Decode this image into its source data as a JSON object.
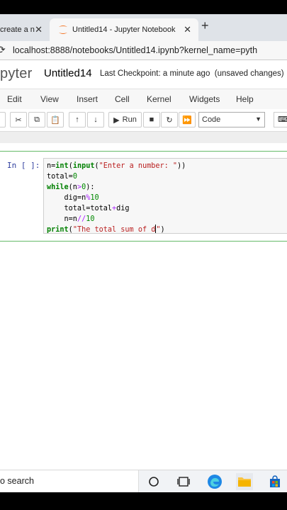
{
  "browser": {
    "tabs": [
      {
        "label": "create a n"
      },
      {
        "label": "Untitled14 - Jupyter Notebook"
      }
    ],
    "new_tab": "+",
    "url": "localhost:8888/notebooks/Untitled14.ipynb?kernel_name=pyth"
  },
  "jupyter": {
    "brand": "pyter",
    "notebook_title": "Untitled14",
    "checkpoint": "Last Checkpoint: a minute ago",
    "status": "(unsaved changes)"
  },
  "menu": {
    "items": [
      "Edit",
      "View",
      "Insert",
      "Cell",
      "Kernel",
      "Widgets",
      "Help"
    ]
  },
  "toolbar": {
    "run_label": "Run",
    "cell_type": "Code"
  },
  "cell": {
    "prompt": "In [ ]:",
    "lines": [
      "n=int(input(\"Enter a number: \"))",
      "total=0",
      "while(n>0):",
      "    dig=n%10",
      "    total=total+dig",
      "    n=n//10",
      "print(\"The total sum of d\")"
    ]
  },
  "taskbar": {
    "search_text": "o search"
  },
  "colors": {
    "jupyter_orange": "#f37626",
    "cell_border_green": "#66bb6a",
    "prompt_blue": "#303f9f"
  }
}
